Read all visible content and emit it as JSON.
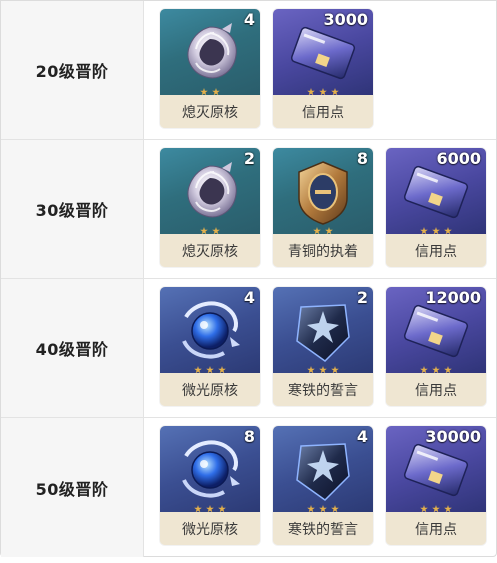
{
  "rows": [
    {
      "level": "20级晋阶",
      "items": [
        {
          "name": "熄灭原核",
          "count": "4",
          "icon": "spiral-core-icon",
          "theme": "green"
        },
        {
          "name": "信用点",
          "count": "3000",
          "icon": "credit-card-icon",
          "theme": "gold"
        }
      ]
    },
    {
      "level": "30级晋阶",
      "items": [
        {
          "name": "熄灭原核",
          "count": "2",
          "icon": "spiral-core-icon",
          "theme": "green"
        },
        {
          "name": "青铜的执着",
          "count": "8",
          "icon": "bronze-badge-icon",
          "theme": "green"
        },
        {
          "name": "信用点",
          "count": "6000",
          "icon": "credit-card-icon",
          "theme": "gold"
        }
      ]
    },
    {
      "level": "40级晋阶",
      "items": [
        {
          "name": "微光原核",
          "count": "4",
          "icon": "glowing-core-icon",
          "theme": "blue"
        },
        {
          "name": "寒铁的誓言",
          "count": "2",
          "icon": "iron-shield-icon",
          "theme": "blue"
        },
        {
          "name": "信用点",
          "count": "12000",
          "icon": "credit-card-icon",
          "theme": "gold"
        }
      ]
    },
    {
      "level": "50级晋阶",
      "items": [
        {
          "name": "微光原核",
          "count": "8",
          "icon": "glowing-core-icon",
          "theme": "blue"
        },
        {
          "name": "寒铁的誓言",
          "count": "4",
          "icon": "iron-shield-icon",
          "theme": "blue"
        },
        {
          "name": "信用点",
          "count": "30000",
          "icon": "credit-card-icon",
          "theme": "gold"
        }
      ]
    }
  ]
}
